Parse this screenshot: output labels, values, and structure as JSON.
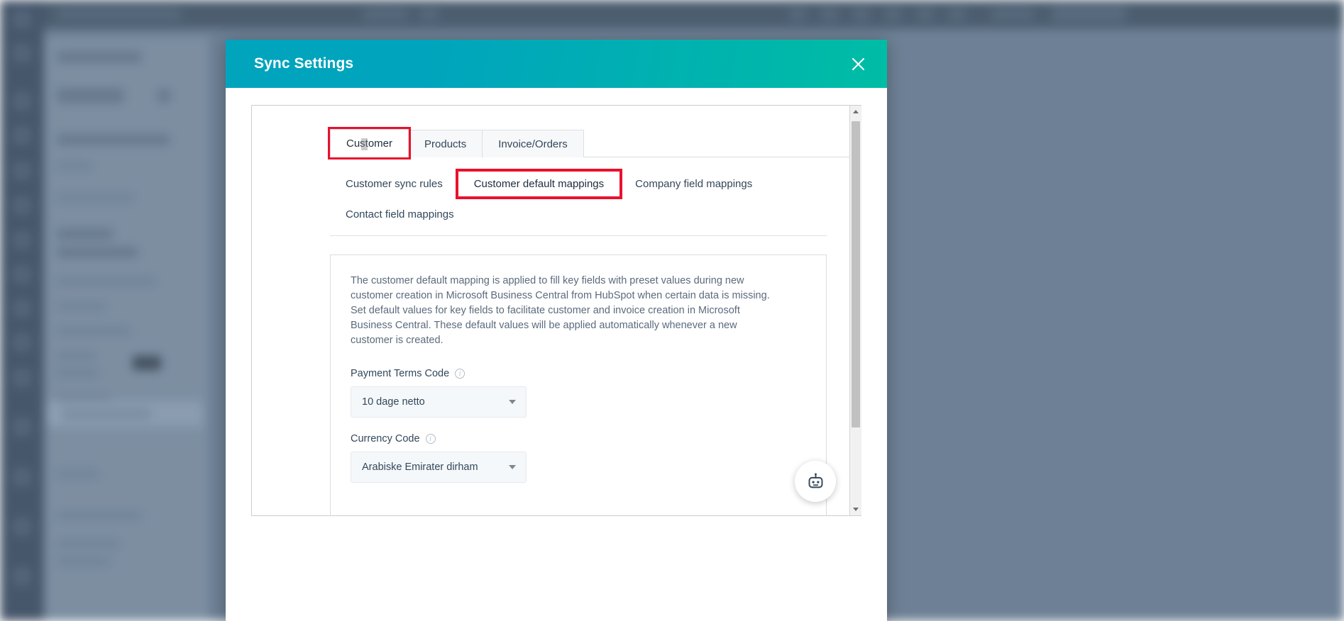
{
  "modal": {
    "title": "Sync Settings",
    "close_label": "Close",
    "main_tabs": [
      {
        "label": "Customer",
        "active": true,
        "highlighted": true
      },
      {
        "label": "Products",
        "active": false,
        "highlighted": false
      },
      {
        "label": "Invoice/Orders",
        "active": false,
        "highlighted": false
      }
    ],
    "sub_tabs": [
      {
        "label": "Customer sync rules",
        "active": false,
        "highlighted": false
      },
      {
        "label": "Customer default mappings",
        "active": true,
        "highlighted": true
      },
      {
        "label": "Company field mappings",
        "active": false,
        "highlighted": false
      },
      {
        "label": "Contact field mappings",
        "active": false,
        "highlighted": false
      }
    ],
    "info_paragraph": "The customer default mapping is applied to fill key fields with preset values during new customer creation in Microsoft Business Central from HubSpot when certain data is missing. Set default values for key fields to facilitate customer and invoice creation in Microsoft Business Central. These default values will be applied automatically whenever a new customer is created.",
    "fields": [
      {
        "label": "Payment Terms Code",
        "value": "10 dage netto",
        "info_icon": "info-icon",
        "caret_icon": "chevron-down-icon"
      },
      {
        "label": "Currency Code",
        "value": "Arabiske Emirater dirham",
        "info_icon": "info-icon",
        "caret_icon": "chevron-down-icon"
      }
    ],
    "scrollbar": {
      "up_icon": "scroll-up-arrow-icon",
      "down_icon": "scroll-down-arrow-icon"
    }
  },
  "chat": {
    "icon": "chat-bot-icon"
  },
  "colors": {
    "header_start": "#00a4bd",
    "header_end": "#00bda5",
    "highlight": "#e8112d",
    "text": "#33475b",
    "muted_text": "#5b6b7c",
    "field_bg": "#f5f8fa",
    "app_nav": "#33475b"
  }
}
